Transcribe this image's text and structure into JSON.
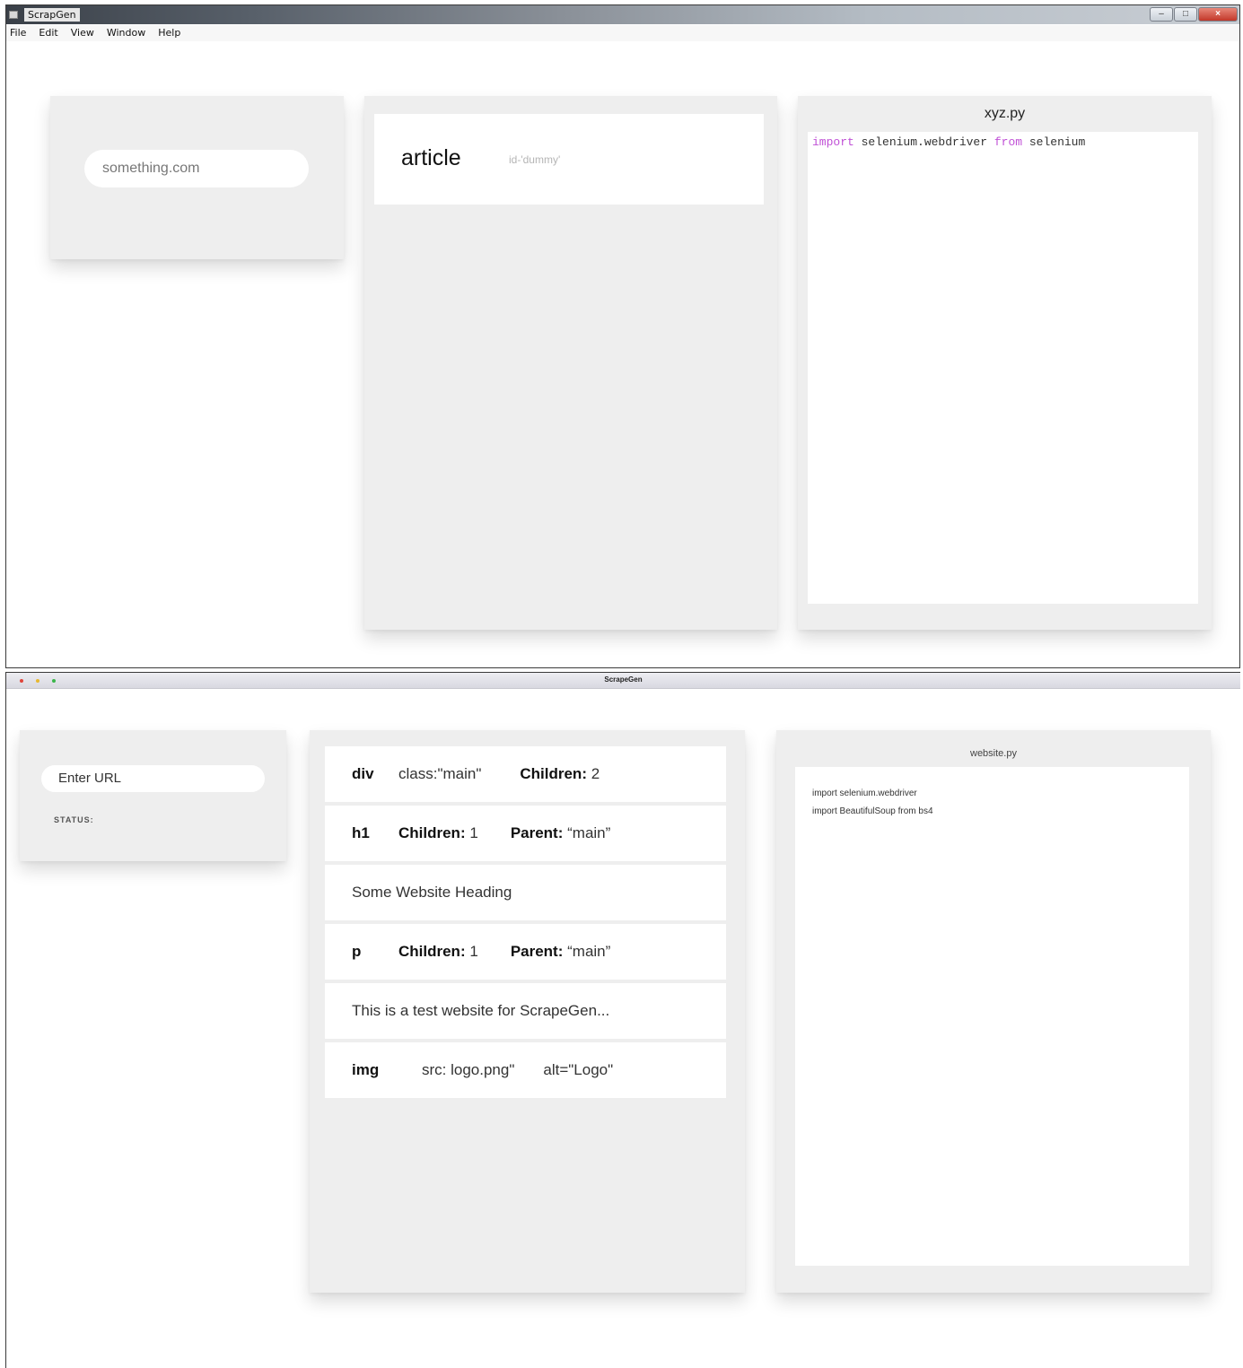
{
  "window1": {
    "title": "ScrapGen",
    "menu": [
      "File",
      "Edit",
      "View",
      "Window",
      "Help"
    ],
    "url_input": "something.com",
    "element": {
      "tag": "article",
      "attr": "id-'dummy'"
    },
    "editor": {
      "filename": "xyz.py",
      "code": [
        {
          "text": "import",
          "keyword": true
        },
        {
          "text": " selenium.webdriver ",
          "keyword": false
        },
        {
          "text": "from",
          "keyword": true
        },
        {
          "text": " selenium",
          "keyword": false
        }
      ]
    }
  },
  "window2": {
    "title": "ScrapeGen",
    "url_placeholder": "Enter URL",
    "status_label": "STATUS:",
    "nodes": [
      {
        "tag": "div",
        "parts": [
          {
            "lbl": "",
            "val": "class:\"main\""
          },
          {
            "lbl": "Children:",
            "val": "2"
          }
        ]
      },
      {
        "tag": "h1",
        "parts": [
          {
            "lbl": "Children:",
            "val": "1"
          },
          {
            "lbl": "Parent:",
            "val": "“main”"
          }
        ]
      },
      {
        "text": "Some Website Heading"
      },
      {
        "tag": "p",
        "parts": [
          {
            "lbl": "Children:",
            "val": "1"
          },
          {
            "lbl": "Parent:",
            "val": "“main”"
          }
        ]
      },
      {
        "text": "This is a test website for ScrapeGen..."
      },
      {
        "tag": "img",
        "parts": [
          {
            "lbl": "",
            "val": "src: logo.png\""
          },
          {
            "lbl": "",
            "val": "alt=\"Logo\""
          }
        ]
      }
    ],
    "editor": {
      "filename": "website.py",
      "lines": [
        "import selenium.webdriver",
        "import BeautifulSoup from  bs4"
      ]
    }
  }
}
